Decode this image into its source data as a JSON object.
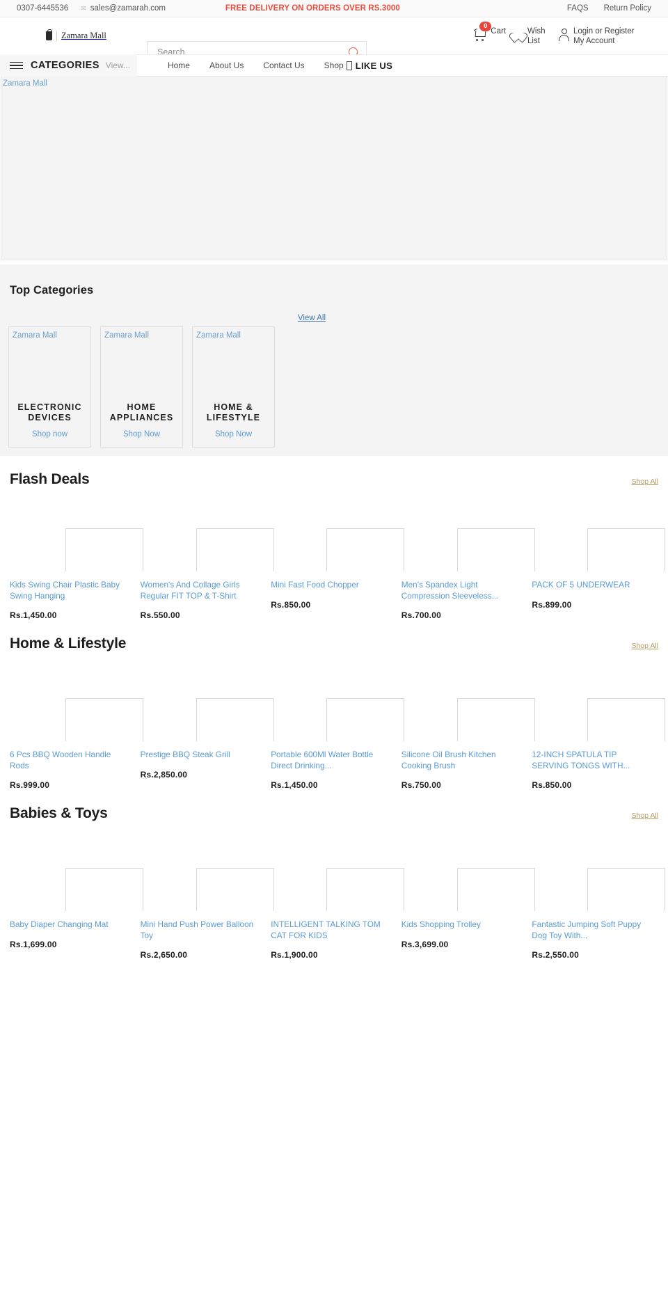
{
  "topbar": {
    "phone": "0307-6445536",
    "mail_icon": "envelope-icon",
    "email": "sales@zamarah.com",
    "promo": "FREE DELIVERY ON ORDERS OVER RS.3000",
    "links": [
      {
        "label": "FAQS"
      },
      {
        "label": "Return Policy"
      }
    ]
  },
  "header": {
    "brand_icon": "shopping-bag-icon",
    "brand_name": "Zamara Mall",
    "search": {
      "placeholder": "Search",
      "value": "",
      "icon": "search-icon"
    },
    "cart": {
      "icon": "cart-icon",
      "count": "0",
      "label": "Cart"
    },
    "wishlist": {
      "icon": "heart-icon",
      "label": "Wish List"
    },
    "account": {
      "icon": "user-icon",
      "line1": "Login or Register",
      "line2": "My Account"
    }
  },
  "nav": {
    "menu_icon": "hamburger-icon",
    "categories_label": "CATEGORIES",
    "categories_sub": "View...",
    "links": [
      {
        "label": "Home"
      },
      {
        "label": "About Us"
      },
      {
        "label": "Contact Us"
      },
      {
        "label": "Shop"
      }
    ],
    "like_icon": "facebook-icon",
    "like_label": "LIKE US"
  },
  "hero": {
    "alt_text": "Zamara Mall"
  },
  "top_categories": {
    "title": "Top Categories",
    "view_all": "View All",
    "cards": [
      {
        "alt": "Zamara Mall",
        "title": "ELECTRONIC DEVICES",
        "cta": "Shop now"
      },
      {
        "alt": "Zamara Mall",
        "title": "HOME APPLIANCES",
        "cta": "Shop Now"
      },
      {
        "alt": "Zamara Mall",
        "title": "HOME & LIFESTYLE",
        "cta": "Shop Now"
      }
    ]
  },
  "sections": [
    {
      "title": "Flash Deals",
      "shop_all": "Shop All",
      "products": [
        {
          "name": "Kids Swing Chair Plastic Baby Swing Hanging",
          "price": "Rs.1,450.00"
        },
        {
          "name": "Women's And Collage Girls Regular FIT TOP & T-Shirt",
          "price": "Rs.550.00"
        },
        {
          "name": "Mini Fast Food Chopper",
          "price": "Rs.850.00"
        },
        {
          "name": "Men's Spandex Light Compression Sleeveless...",
          "price": "Rs.700.00"
        },
        {
          "name": "PACK OF 5 UNDERWEAR",
          "price": "Rs.899.00"
        }
      ]
    },
    {
      "title": "Home & Lifestyle",
      "shop_all": "Shop All",
      "products": [
        {
          "name": "6 Pcs BBQ Wooden Handle Rods",
          "price": "Rs.999.00"
        },
        {
          "name": "Prestige BBQ Steak Grill",
          "price": "Rs.2,850.00"
        },
        {
          "name": "Portable 600Ml Water Bottle Direct Drinking...",
          "price": "Rs.1,450.00"
        },
        {
          "name": "Silicone Oil Brush Kitchen Cooking Brush",
          "price": "Rs.750.00"
        },
        {
          "name": "12-INCH SPATULA TIP SERVING TONGS WITH...",
          "price": "Rs.850.00"
        }
      ]
    },
    {
      "title": "Babies & Toys",
      "shop_all": "Shop All",
      "products": [
        {
          "name": "Baby Diaper Changing Mat",
          "price": "Rs.1,699.00"
        },
        {
          "name": "Mini Hand Push Power Balloon Toy",
          "price": "Rs.2,650.00"
        },
        {
          "name": "INTELLIGENT TALKING TOM CAT FOR KIDS",
          "price": "Rs.1,900.00"
        },
        {
          "name": "Kids Shopping Trolley",
          "price": "Rs.3,699.00"
        },
        {
          "name": "Fantastic Jumping Soft Puppy Dog Toy With...",
          "price": "Rs.2,550.00"
        }
      ]
    }
  ],
  "colors": {
    "promo": "#e74c3c",
    "link": "#5b9bd5",
    "shop_all": "#b59a5e",
    "badge": "#e8453c"
  }
}
